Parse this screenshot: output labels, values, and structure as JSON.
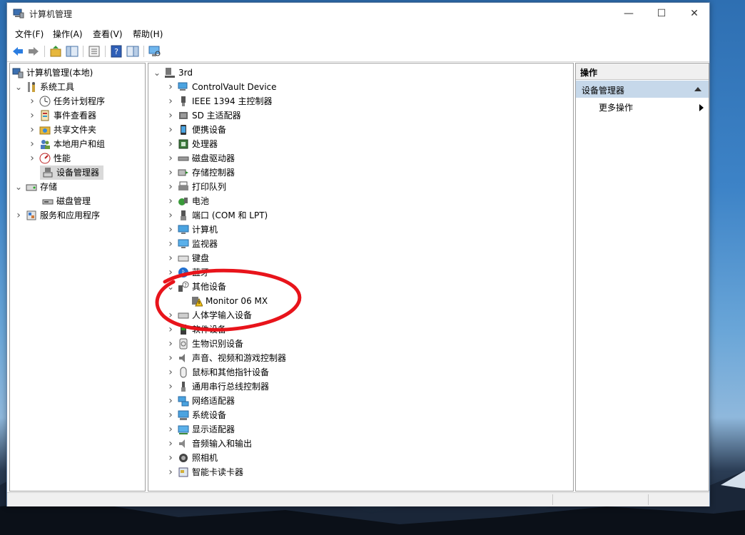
{
  "window": {
    "title": "计算机管理"
  },
  "menu": [
    "文件(F)",
    "操作(A)",
    "查看(V)",
    "帮助(H)"
  ],
  "left_tree": [
    {
      "label": "计算机管理(本地)",
      "icon": "computer-management-icon",
      "chev": ""
    },
    {
      "label": "系统工具",
      "icon": "tools-icon",
      "chev": "v"
    },
    {
      "label": "任务计划程序",
      "icon": "clock-icon",
      "chev": ">"
    },
    {
      "label": "事件查看器",
      "icon": "event-viewer-icon",
      "chev": ">"
    },
    {
      "label": "共享文件夹",
      "icon": "shared-folder-icon",
      "chev": ">"
    },
    {
      "label": "本地用户和组",
      "icon": "users-icon",
      "chev": ">"
    },
    {
      "label": "性能",
      "icon": "performance-icon",
      "chev": ">"
    },
    {
      "label": "设备管理器",
      "icon": "device-manager-icon",
      "chev": ""
    },
    {
      "label": "存储",
      "icon": "storage-icon",
      "chev": "v"
    },
    {
      "label": "磁盘管理",
      "icon": "disk-icon",
      "chev": ""
    },
    {
      "label": "服务和应用程序",
      "icon": "services-icon",
      "chev": ">"
    }
  ],
  "device_tree": {
    "root": "3rd",
    "items": [
      {
        "label": "ControlVault Device",
        "icon": "controlvault-icon"
      },
      {
        "label": "IEEE 1394 主控制器",
        "icon": "ieee1394-icon"
      },
      {
        "label": "SD 主适配器",
        "icon": "sd-card-icon"
      },
      {
        "label": "便携设备",
        "icon": "portable-device-icon"
      },
      {
        "label": "处理器",
        "icon": "processor-icon"
      },
      {
        "label": "磁盘驱动器",
        "icon": "disk-drive-icon"
      },
      {
        "label": "存储控制器",
        "icon": "storage-controller-icon"
      },
      {
        "label": "打印队列",
        "icon": "printer-icon"
      },
      {
        "label": "电池",
        "icon": "battery-icon"
      },
      {
        "label": "端口 (COM 和 LPT)",
        "icon": "port-icon"
      },
      {
        "label": "计算机",
        "icon": "computer-icon"
      },
      {
        "label": "监视器",
        "icon": "monitor-icon"
      },
      {
        "label": "键盘",
        "icon": "keyboard-icon"
      },
      {
        "label": "蓝牙",
        "icon": "bluetooth-icon"
      },
      {
        "label": "其他设备",
        "icon": "unknown-device-icon",
        "expanded": true
      },
      {
        "label": "Monitor 06 MX",
        "icon": "warning-device-icon",
        "child": true
      },
      {
        "label": "人体学输入设备",
        "icon": "hid-icon"
      },
      {
        "label": "软件设备",
        "icon": "software-device-icon"
      },
      {
        "label": "生物识别设备",
        "icon": "fingerprint-icon"
      },
      {
        "label": "声音、视频和游戏控制器",
        "icon": "sound-icon"
      },
      {
        "label": "鼠标和其他指针设备",
        "icon": "mouse-icon"
      },
      {
        "label": "通用串行总线控制器",
        "icon": "usb-icon"
      },
      {
        "label": "网络适配器",
        "icon": "network-icon"
      },
      {
        "label": "系统设备",
        "icon": "system-device-icon"
      },
      {
        "label": "显示适配器",
        "icon": "display-adapter-icon"
      },
      {
        "label": "音频输入和输出",
        "icon": "audio-io-icon"
      },
      {
        "label": "照相机",
        "icon": "camera-icon"
      },
      {
        "label": "智能卡读卡器",
        "icon": "smartcard-icon"
      }
    ]
  },
  "actions": {
    "header": "操作",
    "selected": "设备管理器",
    "more": "更多操作"
  },
  "colors": {
    "selection": "#d9d9d9",
    "action_selected": "#c6d8ea",
    "annotation": "#e8141b"
  }
}
